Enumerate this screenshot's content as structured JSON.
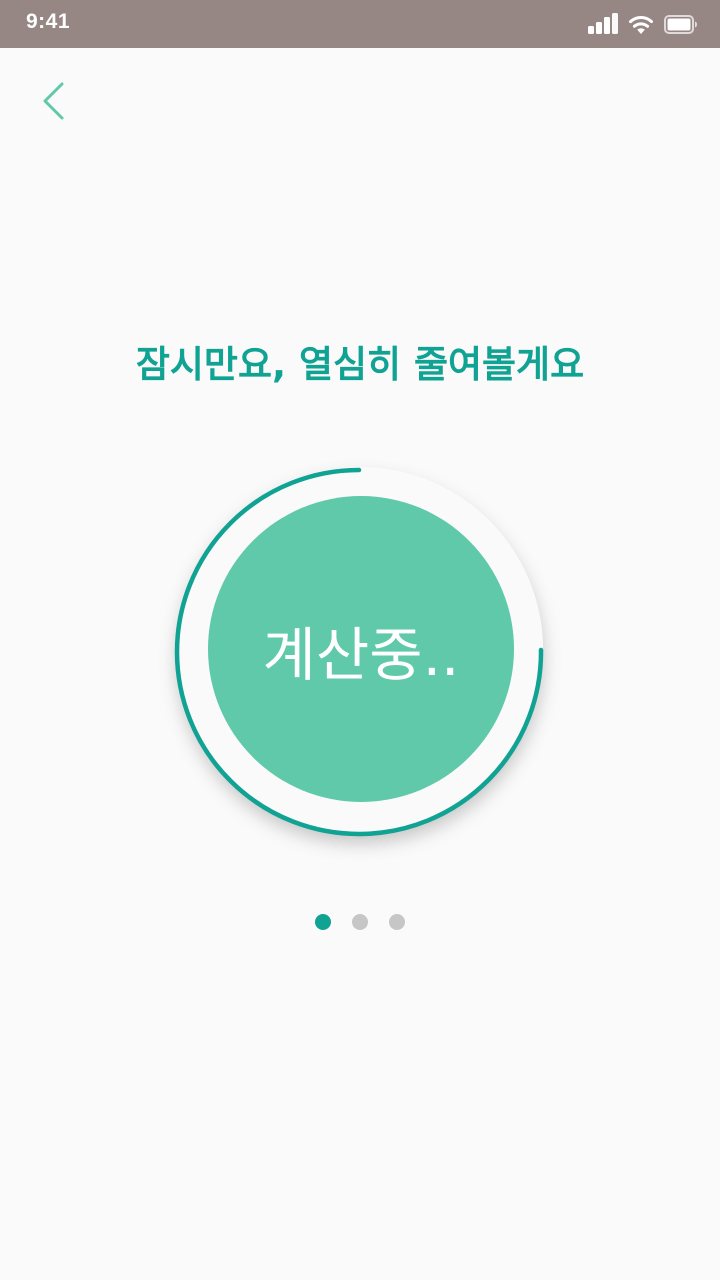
{
  "status_bar": {
    "time": "9:41",
    "signal_icon": "cellular-signal-icon",
    "wifi_icon": "wifi-icon",
    "battery_icon": "battery-icon"
  },
  "nav": {
    "back_icon": "chevron-left-icon"
  },
  "main": {
    "headline": "잠시만요, 열심히 줄여볼게요",
    "progress_label": "계산중.."
  },
  "pagination": {
    "total": 3,
    "active_index": 0
  },
  "colors": {
    "accent": "#10a293",
    "circle_fill": "#5fc9aa",
    "status_bar": "#968785",
    "background": "#fafafa",
    "dot_inactive": "#c6c6c6"
  }
}
